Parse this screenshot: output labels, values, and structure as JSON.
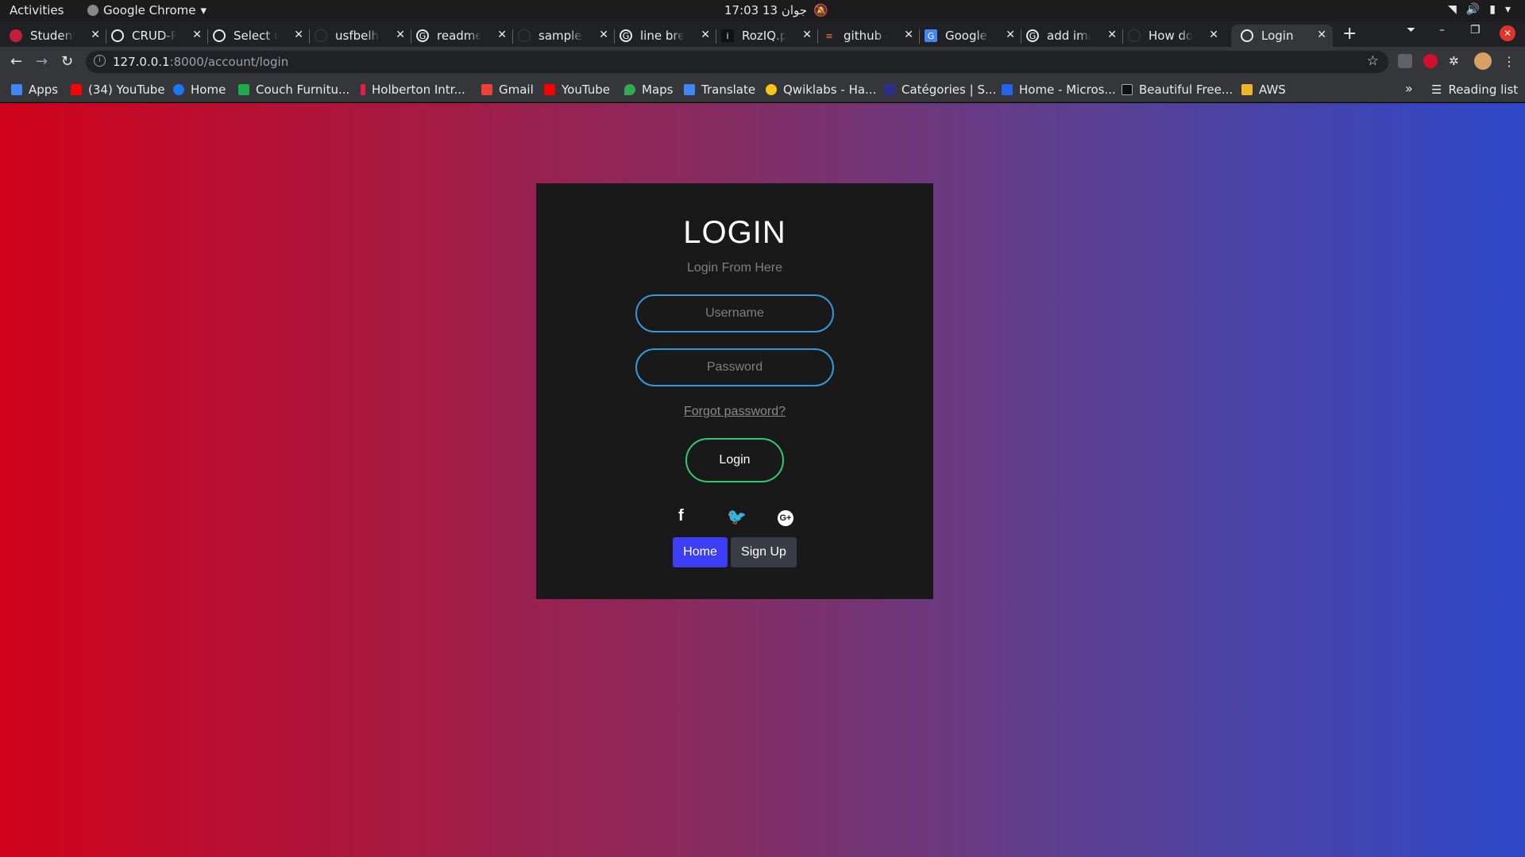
{
  "topbar": {
    "activities": "Activities",
    "app_name": "Google Chrome",
    "clock": "17:03  13 جوان"
  },
  "tabs": [
    {
      "label": "Student c",
      "icon_color": "#c41e3a"
    },
    {
      "label": "CRUD-Pro",
      "icon_color": "#e8eaed"
    },
    {
      "label": "Select use",
      "icon_color": "#e8eaed"
    },
    {
      "label": "usfbelha",
      "icon_color": "#202124"
    },
    {
      "label": "readme fo",
      "icon_color": "#4285f4"
    },
    {
      "label": "sample-c",
      "icon_color": "#202124"
    },
    {
      "label": "line break",
      "icon_color": "#4285f4"
    },
    {
      "label": "RozIQ.pn",
      "icon_color": "#111111"
    },
    {
      "label": "github - h",
      "icon_color": "#f48024"
    },
    {
      "label": "Google Tr",
      "icon_color": "#4285f4"
    },
    {
      "label": "add imag",
      "icon_color": "#4285f4"
    },
    {
      "label": "How do y",
      "icon_color": "#202124"
    },
    {
      "label": "Login",
      "icon_color": "#e8eaed"
    }
  ],
  "address": {
    "host": "127.0.0.1",
    "path": ":8000/account/login"
  },
  "bookmarks": [
    {
      "label": "Apps",
      "color": "#4285f4"
    },
    {
      "label": "(34) YouTube",
      "color": "#ff0000"
    },
    {
      "label": "Home",
      "color": "#1877f2"
    },
    {
      "label": "Couch Furnitu...",
      "color": "#21a84a"
    },
    {
      "label": "Holberton Intr...",
      "color": "#e11d48"
    },
    {
      "label": "Gmail",
      "color": "#ea4335"
    },
    {
      "label": "YouTube",
      "color": "#ff0000"
    },
    {
      "label": "Maps",
      "color": "#34a853"
    },
    {
      "label": "Translate",
      "color": "#4285f4"
    },
    {
      "label": "Qwiklabs - Ha...",
      "color": "#f5c518"
    },
    {
      "label": "Catégories | S...",
      "color": "#2d2f8f"
    },
    {
      "label": "Home - Micros...",
      "color": "#2563eb"
    },
    {
      "label": "Beautiful Free...",
      "color": "#111111"
    },
    {
      "label": "AWS",
      "color": "#f0b429"
    }
  ],
  "reading_list": "Reading list",
  "login": {
    "title": "LOGIN",
    "subtitle": "Login From Here",
    "username_placeholder": "Username",
    "password_placeholder": "Password",
    "forgot": "Forgot password?",
    "submit": "Login",
    "home": "Home",
    "signup": "Sign Up"
  }
}
